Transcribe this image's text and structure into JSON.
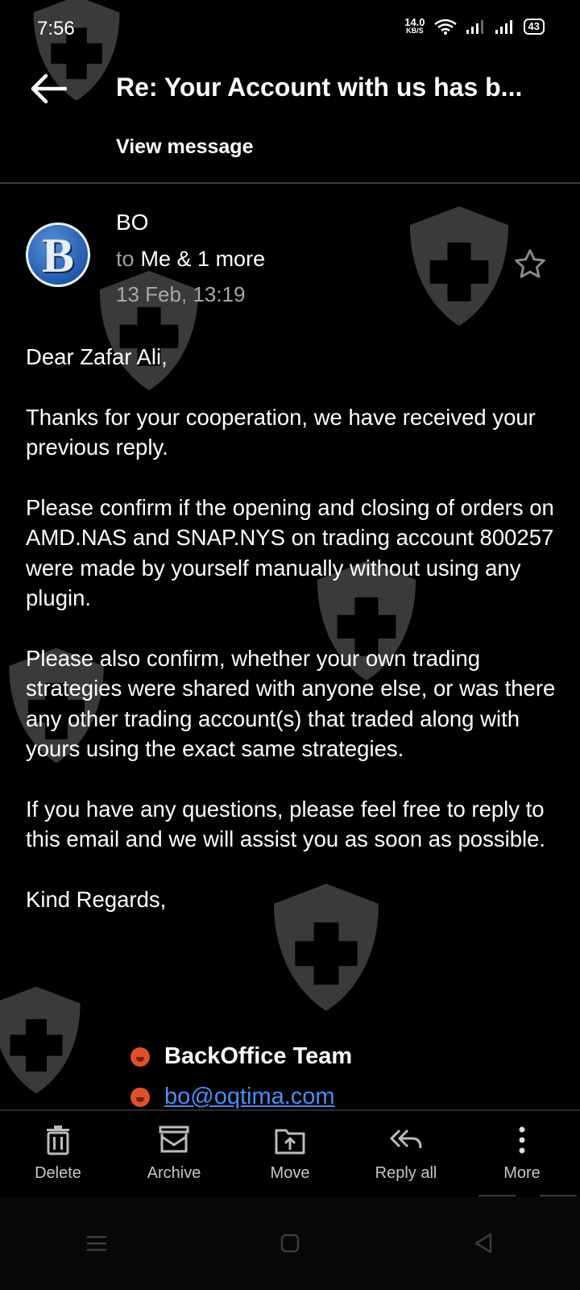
{
  "status_bar": {
    "time": "7:56",
    "speed": "14.0",
    "speed_unit": "KB/S",
    "battery": "43"
  },
  "app_bar": {
    "title": "Re: Your Account with us has b...",
    "subtitle": "View message"
  },
  "header": {
    "avatar_letter": "B",
    "sender": "BO",
    "to_label": "to",
    "recipients": "Me & 1 more",
    "date": "13 Feb, 13:19"
  },
  "body": {
    "paragraphs": [
      "Dear Zafar Ali,",
      "Thanks for your cooperation, we have received your previous reply.",
      "Please confirm if the opening and closing of orders on AMD.NAS and SNAP.NYS on trading account 800257 were made by yourself manually without using any plugin.",
      "Please also confirm, whether your own trading strategies were shared with anyone else, or was there any other trading account(s) that traded along with yours using the exact same strategies.",
      "If you have any questions, please feel free to reply to this email and we will assist you as soon as possible.",
      "Kind Regards,"
    ],
    "signature_name": "BackOffice Team",
    "signature_email": "bo@oqtima.com"
  },
  "actions": [
    {
      "label": "Delete",
      "icon": "trash-icon"
    },
    {
      "label": "Archive",
      "icon": "archive-icon"
    },
    {
      "label": "Move",
      "icon": "move-icon"
    },
    {
      "label": "Reply all",
      "icon": "reply-all-icon"
    },
    {
      "label": "More",
      "icon": "more-vert-icon"
    }
  ],
  "colors": {
    "background": "#000000",
    "link": "#4a8ef2",
    "muted": "#a8a8a8",
    "watermark": "#3d3d3d"
  }
}
